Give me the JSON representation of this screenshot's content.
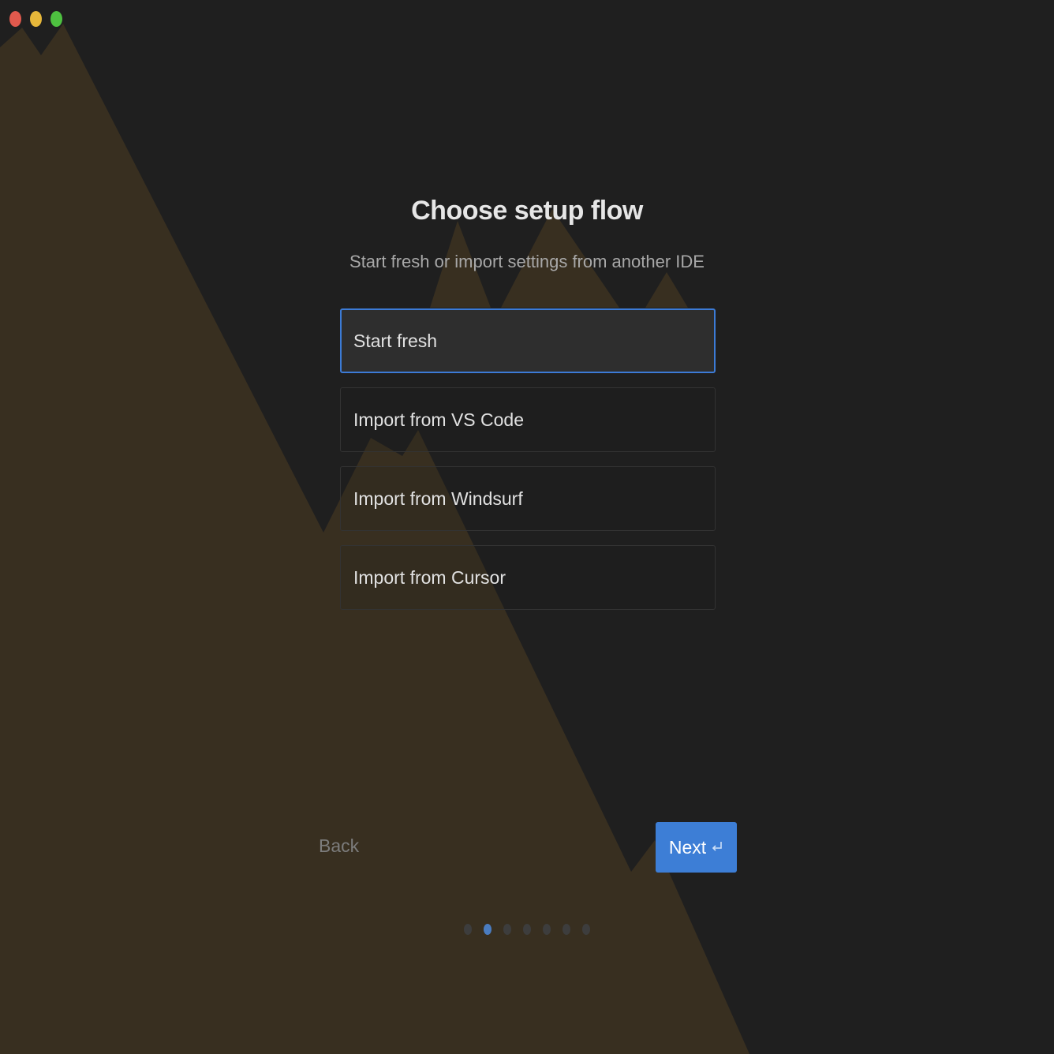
{
  "window": {
    "controls": [
      "close",
      "minimize",
      "zoom"
    ],
    "colors": {
      "close": "#e0594d",
      "minimize": "#e6b73a",
      "zoom": "#4ec140"
    }
  },
  "header": {
    "title": "Choose setup flow",
    "subtitle": "Start fresh or import settings from another IDE"
  },
  "options": [
    {
      "label": "Start fresh",
      "selected": true
    },
    {
      "label": "Import from VS Code",
      "selected": false
    },
    {
      "label": "Import from Windsurf",
      "selected": false
    },
    {
      "label": "Import from Cursor",
      "selected": false
    }
  ],
  "footer": {
    "back_label": "Back",
    "next_label": "Next",
    "next_icon": "enter-key-icon"
  },
  "pager": {
    "total": 7,
    "active_index": 1
  },
  "colors": {
    "accent": "#3d7ed6",
    "background": "#1f1f1f",
    "art": "#382f20"
  }
}
